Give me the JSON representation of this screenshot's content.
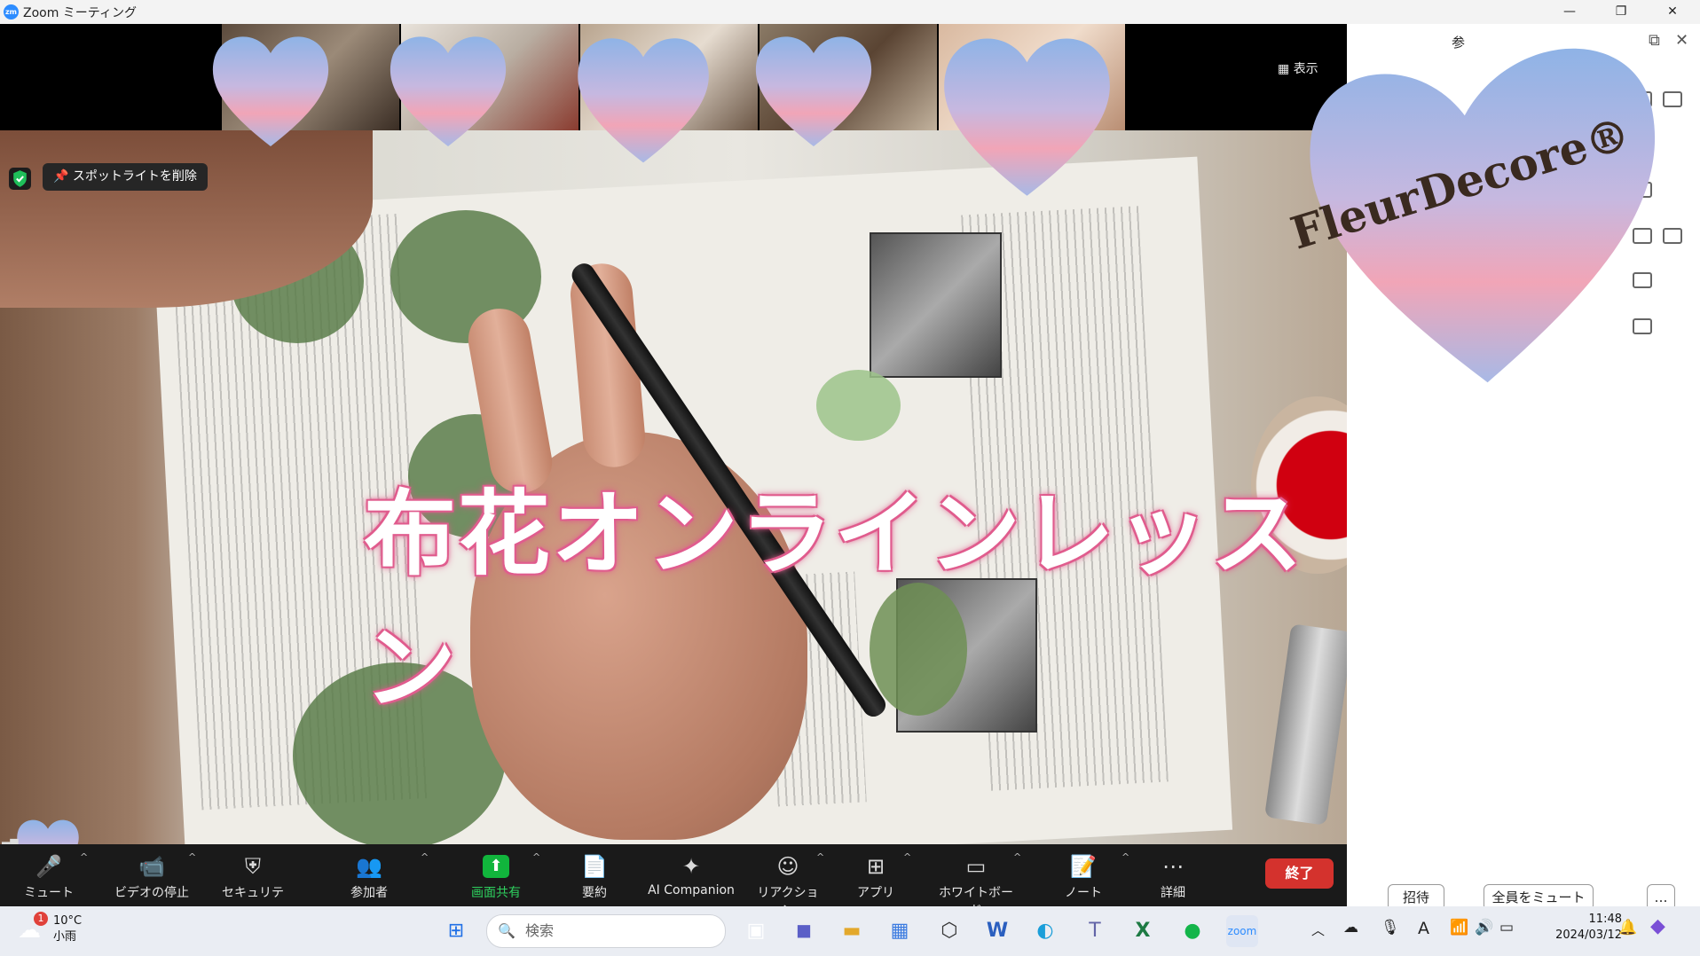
{
  "window": {
    "title": "Zoom ミーティング",
    "app_icon": "zoom-logo",
    "logo_text": "zm"
  },
  "meeting": {
    "view_label": "表示",
    "spotlight_label": "スポットライトを削除",
    "overlay_title": "布花オンラインレッスン",
    "brand_overlay": "FleurDecore®",
    "accent_color": "#e05a8d",
    "thumbnails_count_visible": 5
  },
  "toolbar": {
    "items": [
      {
        "label": "ミュート",
        "icon": "microphone-icon"
      },
      {
        "label": "ビデオの停止",
        "icon": "video-camera-icon"
      },
      {
        "label": "セキュリティ",
        "icon": "shield-icon"
      },
      {
        "label": "参加者",
        "icon": "participants-icon"
      },
      {
        "label": "画面共有",
        "icon": "share-screen-icon"
      },
      {
        "label": "要約",
        "icon": "summary-icon"
      },
      {
        "label": "AI Companion",
        "icon": "sparkle-icon"
      },
      {
        "label": "リアクション",
        "icon": "emoji-icon"
      },
      {
        "label": "アプリ",
        "icon": "apps-icon"
      },
      {
        "label": "ホワイトボード",
        "icon": "whiteboard-icon"
      },
      {
        "label": "ノート",
        "icon": "notes-icon"
      },
      {
        "label": "詳細",
        "icon": "more-icon"
      }
    ],
    "end_label": "終了",
    "end_color": "#d4322d",
    "share_color": "#11b53c"
  },
  "panel": {
    "header_initial": "参",
    "invite_label": "招待",
    "mute_all_label": "全員をミュート",
    "more_label": "…"
  },
  "taskbar": {
    "weather_temp": "10°C",
    "weather_desc": "小雨",
    "weather_badge": "1",
    "search_placeholder": "検索",
    "time": "11:48",
    "date": "2024/03/12",
    "ime_label": "A"
  }
}
